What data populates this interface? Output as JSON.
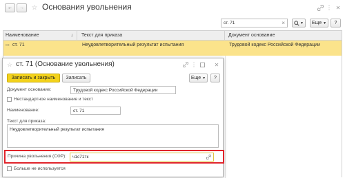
{
  "window": {
    "title": "Основания увольнения",
    "back_glyph": "←",
    "forward_glyph": "→",
    "star_glyph": "☆",
    "link_glyph": "🔗",
    "more_glyph": "⋮",
    "close_glyph": "✕"
  },
  "toolbar": {
    "search_value": "ст. 71",
    "clear_glyph": "×",
    "search_icon": "search-icon",
    "more_label": "Еще",
    "help_label": "?"
  },
  "table": {
    "columns": [
      "Наименование",
      "Текст для приказа",
      "Документ основание"
    ],
    "sort_glyph": "↓",
    "rows": [
      {
        "marker": "▭",
        "name": "ст. 71",
        "text": "Неудовлетворительный результат испытания",
        "doc": "Трудовой кодекс Российской Федерации"
      }
    ]
  },
  "dialog": {
    "title": "ст. 71 (Основание увольнения)",
    "save_close_label": "Записать и закрыть",
    "save_label": "Записать",
    "more_label": "Еще",
    "help_label": "?",
    "doc_basis_label": "Документ основание:",
    "doc_basis_value": "Трудовой кодекс Российской Федерации",
    "nonstandard_label": "Нестандартное наименование и текст",
    "name_label": "Наименование:",
    "name_value": "ст. 71",
    "order_text_label": "Текст для приказа:",
    "order_text_value": "Неудовлетворительный результат испытания",
    "reason_label": "Причина увольнения (СФР):",
    "reason_value": "ч1с71тк",
    "not_used_label": "Больше не используется"
  },
  "colors": {
    "accent_yellow": "#fbe38b",
    "primary_button": "#f3d21b",
    "highlight_red": "#e0232a",
    "header_bg": "#eeeeee"
  }
}
